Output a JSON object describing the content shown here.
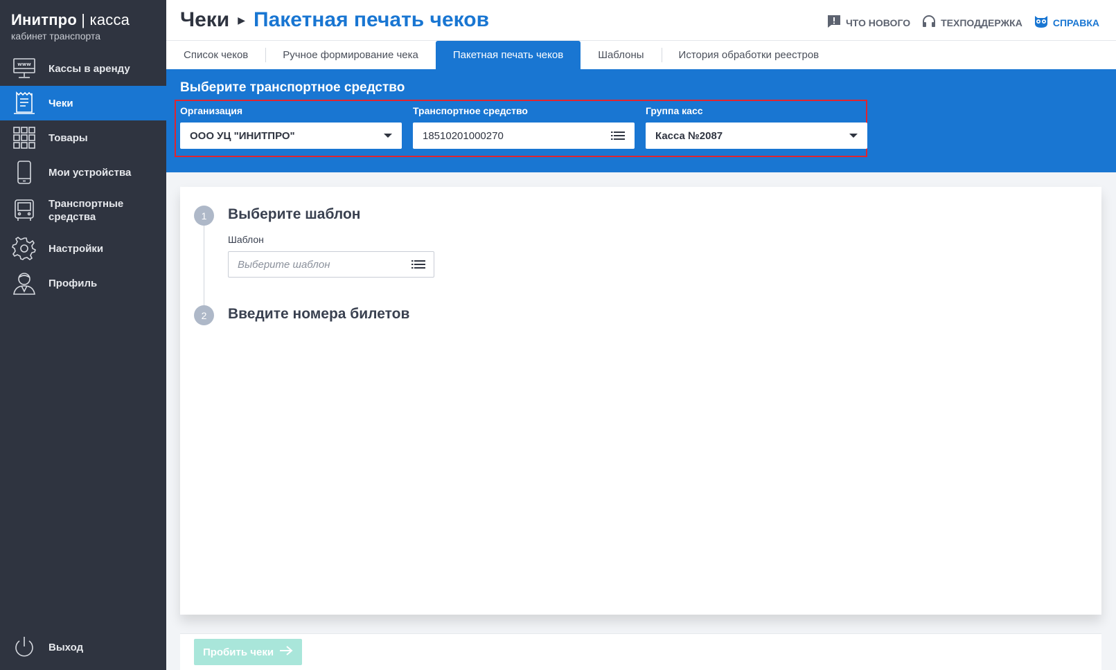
{
  "brand": {
    "title_main": "Инитпро",
    "title_sep": " | ",
    "title_rest": "касса",
    "subtitle": "кабинет транспорта"
  },
  "sidebar": {
    "items": [
      {
        "label": "Кассы в аренду",
        "icon": "www-monitor-icon"
      },
      {
        "label": "Чеки",
        "icon": "receipt-icon",
        "active": true
      },
      {
        "label": "Товары",
        "icon": "grid-icon"
      },
      {
        "label": "Мои устройства",
        "icon": "phone-icon"
      },
      {
        "label": "Транспортные средства",
        "icon": "bus-icon"
      },
      {
        "label": "Настройки",
        "icon": "gear-icon"
      },
      {
        "label": "Профиль",
        "icon": "user-icon"
      }
    ],
    "logout": {
      "label": "Выход",
      "icon": "power-icon"
    }
  },
  "header": {
    "crumb_parent": "Чеки",
    "crumb_current": "Пакетная печать чеков",
    "links": {
      "whats_new": "ЧТО НОВОГО",
      "support": "ТЕХПОДДЕРЖКА",
      "help": "СПРАВКА"
    }
  },
  "tabs": [
    {
      "label": "Список чеков"
    },
    {
      "label": "Ручное формирование чека"
    },
    {
      "label": "Пакетная печать чеков",
      "active": true
    },
    {
      "label": "Шаблоны"
    },
    {
      "label": "История обработки реестров"
    }
  ],
  "selection": {
    "title": "Выберите транспортное средство",
    "organization": {
      "label": "Организация",
      "value": "ООО УЦ \"ИНИТПРО\""
    },
    "vehicle": {
      "label": "Транспортное средство",
      "value": "18510201000270"
    },
    "cash_group": {
      "label": "Группа касс",
      "value": "Касса №2087"
    }
  },
  "steps": {
    "step1": {
      "number": "1",
      "title": "Выберите шаблон",
      "field_label": "Шаблон",
      "placeholder": "Выберите шаблон"
    },
    "step2": {
      "number": "2",
      "title": "Введите номера билетов"
    }
  },
  "footer": {
    "submit_label": "Пробить чеки"
  },
  "colors": {
    "primary": "#1976d2",
    "sidebar_bg": "#2f3440",
    "highlight": "#e0242f",
    "button_disabled": "#a9e6da"
  }
}
